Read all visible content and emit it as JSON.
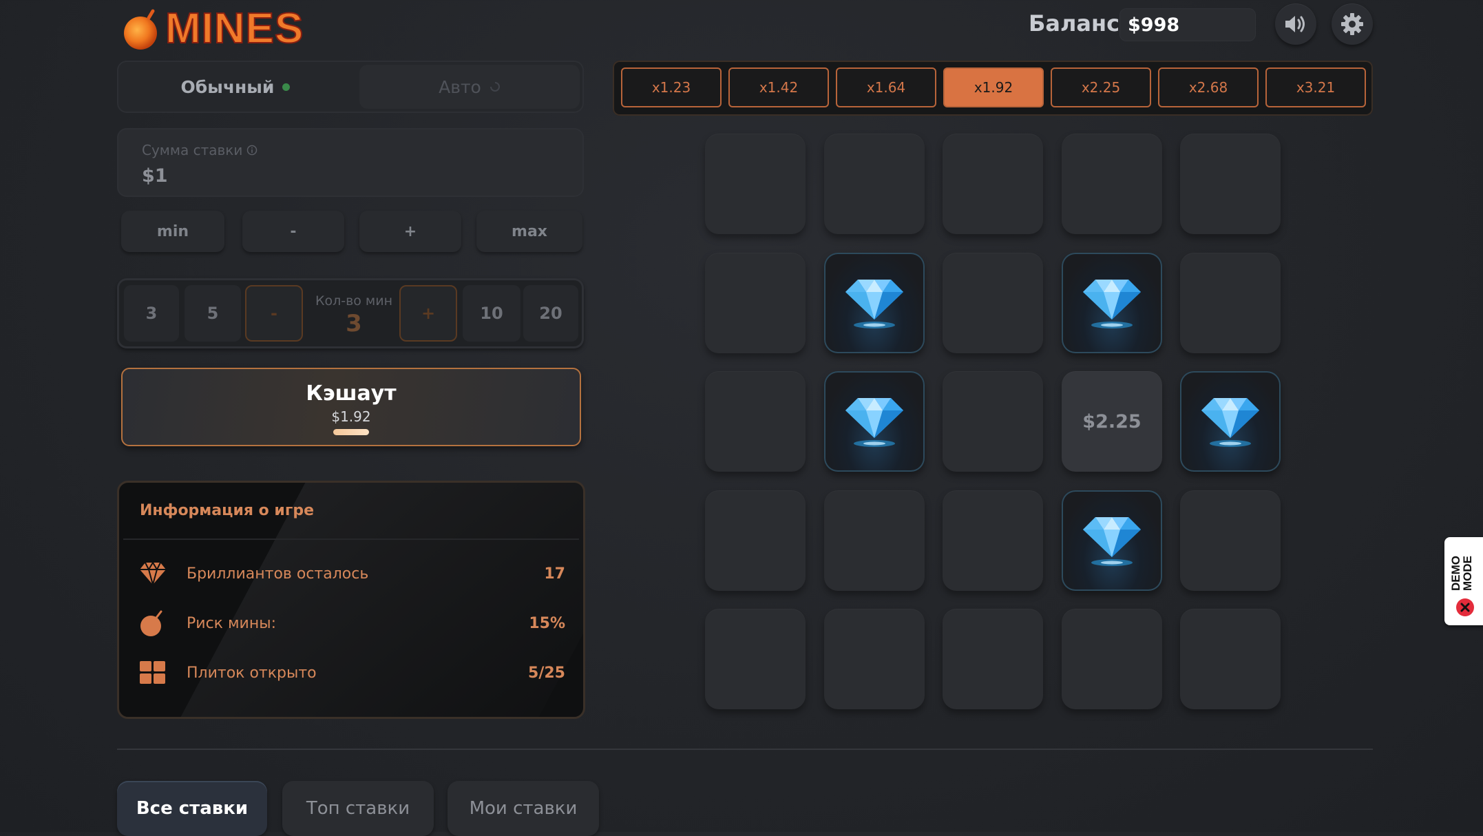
{
  "header": {
    "logo_text": "MINES",
    "balance_label": "Баланс:",
    "balance_value": "$998"
  },
  "mode_tabs": [
    {
      "label": "Обычный",
      "active": true
    },
    {
      "label": "Авто",
      "active": false
    }
  ],
  "bet": {
    "label": "Сумма ставки",
    "value": "$1",
    "buttons": [
      "min",
      "-",
      "+",
      "max"
    ]
  },
  "mines": {
    "presets_left": [
      "3",
      "5"
    ],
    "minus": "-",
    "label": "Кол-во мин",
    "value": "3",
    "plus": "+",
    "presets_right": [
      "10",
      "20"
    ]
  },
  "cashout": {
    "label": "Кэшаут",
    "amount": "$1.92"
  },
  "info": {
    "title": "Информация о игре",
    "rows": [
      {
        "icon": "diamond-icon",
        "label": "Бриллиантов осталось",
        "value": "17"
      },
      {
        "icon": "bomb-icon",
        "label": "Риск мины:",
        "value": "15%"
      },
      {
        "icon": "tiles-icon",
        "label": "Плиток открыто",
        "value": "5/25"
      }
    ]
  },
  "multipliers": [
    "x1.23",
    "x1.42",
    "x1.64",
    "x1.92",
    "x2.25",
    "x2.68",
    "x3.21"
  ],
  "active_multiplier": "x1.92",
  "grid": {
    "rows": 5,
    "cols": 5,
    "tiles": [
      "hidden",
      "hidden",
      "hidden",
      "hidden",
      "hidden",
      "hidden",
      "gem",
      "hidden",
      "gem",
      "hidden",
      "hidden",
      "gem",
      "hidden",
      "value",
      "gem",
      "hidden",
      "hidden",
      "hidden",
      "gem",
      "hidden",
      "hidden",
      "hidden",
      "hidden",
      "hidden",
      "hidden"
    ],
    "revealed_value": "$2.25"
  },
  "bottom_tabs": [
    {
      "label": "Все ставки",
      "active": true
    },
    {
      "label": "Топ ставки",
      "active": false
    },
    {
      "label": "Мои ставки",
      "active": false
    }
  ],
  "demo_badge": "DEMO\nMODE",
  "colors": {
    "accent": "#d97342",
    "gem": "#3fb6f0",
    "status_dot": "#3a8a4a"
  }
}
